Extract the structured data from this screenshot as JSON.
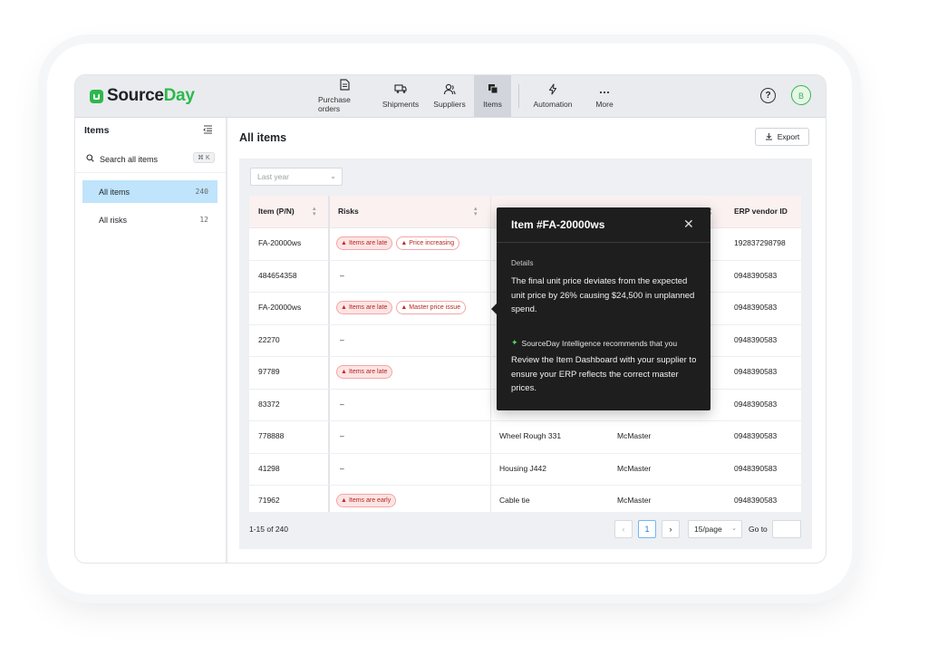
{
  "brand": {
    "name_part1": "Source",
    "name_part2": "Day"
  },
  "nav": [
    {
      "label": "Purchase orders",
      "icon": "file-icon"
    },
    {
      "label": "Shipments",
      "icon": "truck-icon"
    },
    {
      "label": "Suppliers",
      "icon": "users-icon"
    },
    {
      "label": "Items",
      "icon": "items-icon",
      "active": true
    },
    {
      "label": "Automation",
      "icon": "lightning-icon"
    },
    {
      "label": "More",
      "icon": "more-icon"
    }
  ],
  "user": {
    "initial": "B"
  },
  "sidebar": {
    "title": "Items",
    "search_label": "Search all items",
    "shortcut": "⌘ K",
    "items": [
      {
        "label": "All items",
        "count": "240",
        "active": true
      },
      {
        "label": "All risks",
        "count": "12"
      }
    ]
  },
  "main": {
    "title": "All items",
    "export_label": "Export",
    "filter_value": "Last year"
  },
  "table": {
    "columns": [
      "Item (P/N)",
      "Risks",
      "ERP vendor ID"
    ],
    "rows": [
      {
        "pn": "FA-20000ws",
        "risks": [
          "Items are late",
          "Price increasing"
        ],
        "desc": "",
        "supplier": "",
        "vendor": "192837298798"
      },
      {
        "pn": "484654358",
        "risks": [],
        "empty": "–",
        "desc": "",
        "supplier": "",
        "vendor": "0948390583"
      },
      {
        "pn": "FA-20000ws",
        "risks": [
          "Items are late",
          "Master price issue"
        ],
        "desc": "",
        "supplier": "",
        "vendor": "0948390583"
      },
      {
        "pn": "22270",
        "risks": [],
        "empty": "–",
        "desc": "",
        "supplier": "",
        "vendor": "0948390583"
      },
      {
        "pn": "97789",
        "risks": [
          "Items are late"
        ],
        "desc": "",
        "supplier": "",
        "vendor": "0948390583"
      },
      {
        "pn": "83372",
        "risks": [],
        "empty": "–",
        "desc": "",
        "supplier": "",
        "vendor": "0948390583"
      },
      {
        "pn": "778888",
        "risks": [],
        "empty": "–",
        "desc": "Wheel Rough 331",
        "supplier": "McMaster",
        "vendor": "0948390583"
      },
      {
        "pn": "41298",
        "risks": [],
        "empty": "–",
        "desc": "Housing J442",
        "supplier": "McMaster",
        "vendor": "0948390583"
      },
      {
        "pn": "71962",
        "risks": [
          "Items are early"
        ],
        "desc": "Cable tie",
        "supplier": "McMaster",
        "vendor": "0948390583"
      }
    ]
  },
  "pagination": {
    "summary": "1-15 of 240",
    "prev": "‹",
    "current": "1",
    "next": "›",
    "per_page": "15/page",
    "goto_label": "Go to"
  },
  "tooltip": {
    "title": "Item #FA-20000ws",
    "close": "✕",
    "details_label": "Details",
    "details_text": "The final unit price deviates from the expected unit price by 26% causing $24,500 in unplanned spend.",
    "recommend_label": "SourceDay Intelligence recommends that you",
    "recommend_text": "Review the Item Dashboard with your supplier to ensure your ERP reflects the correct master prices."
  },
  "colors": {
    "brand": "#2db84c",
    "active_sidebar": "#bfe4fb",
    "risk": "#c62828",
    "tooltip_bg": "#1e1e1e"
  }
}
